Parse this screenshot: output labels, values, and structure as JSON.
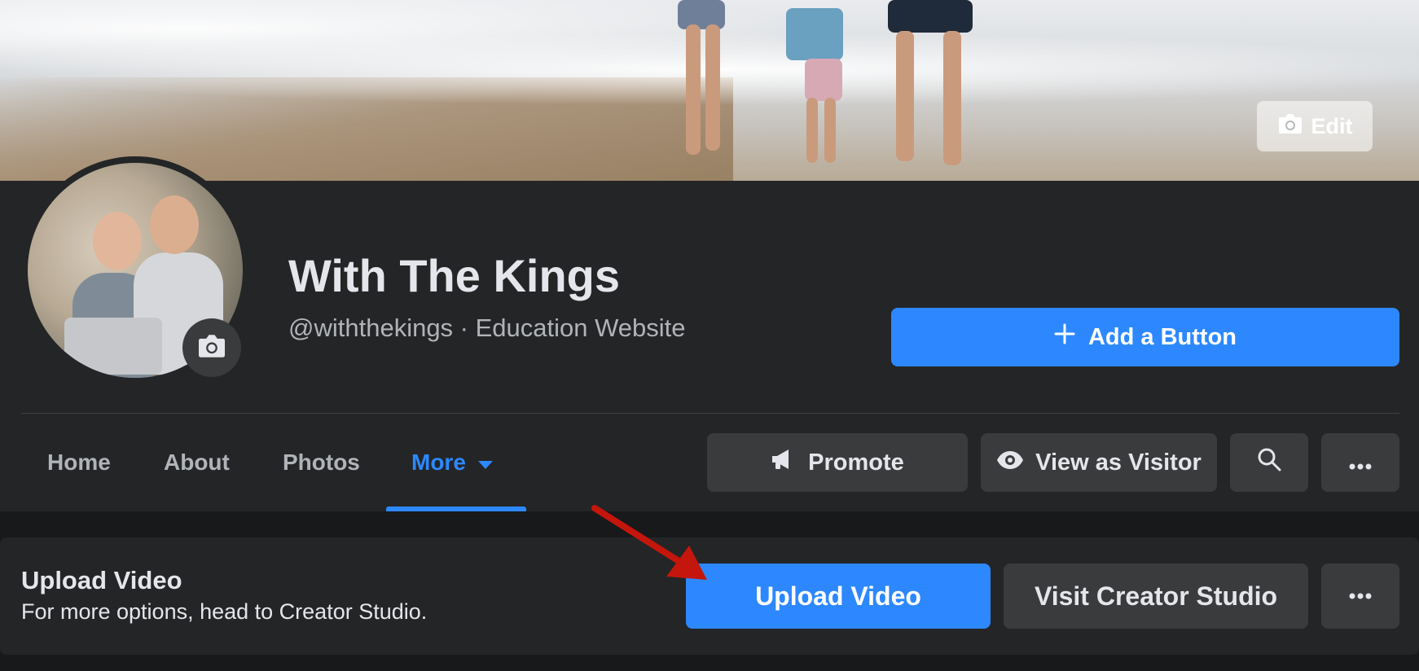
{
  "cover": {
    "edit_label": "Edit",
    "edit_icon": "camera-icon"
  },
  "profile": {
    "name": "With The Kings",
    "subtitle": "@withthekings · Education Website",
    "avatar_icon": "camera-icon"
  },
  "header_actions": {
    "add_button_label": "Add a Button",
    "add_icon": "plus-icon"
  },
  "tabs": [
    {
      "label": "Home"
    },
    {
      "label": "About"
    },
    {
      "label": "Photos"
    },
    {
      "label": "More",
      "active": true,
      "icon": "caret-down-icon"
    }
  ],
  "toolbar": {
    "promote_label": "Promote",
    "promote_icon": "megaphone-icon",
    "view_visitor_label": "View as Visitor",
    "view_visitor_icon": "eye-icon",
    "search_icon": "search-icon",
    "more_icon": "ellipsis-icon"
  },
  "upload_card": {
    "title": "Upload Video",
    "subtitle": "For more options, head to Creator Studio.",
    "upload_label": "Upload Video",
    "creator_label": "Visit Creator Studio",
    "more_icon": "ellipsis-icon"
  },
  "colors": {
    "accent": "#2d88ff",
    "background": "#18191a",
    "surface": "#242526",
    "button_secondary": "#3a3b3c",
    "text_primary": "#e4e6eb",
    "text_secondary": "#b0b3b8",
    "annotation_arrow": "#c4160c"
  }
}
